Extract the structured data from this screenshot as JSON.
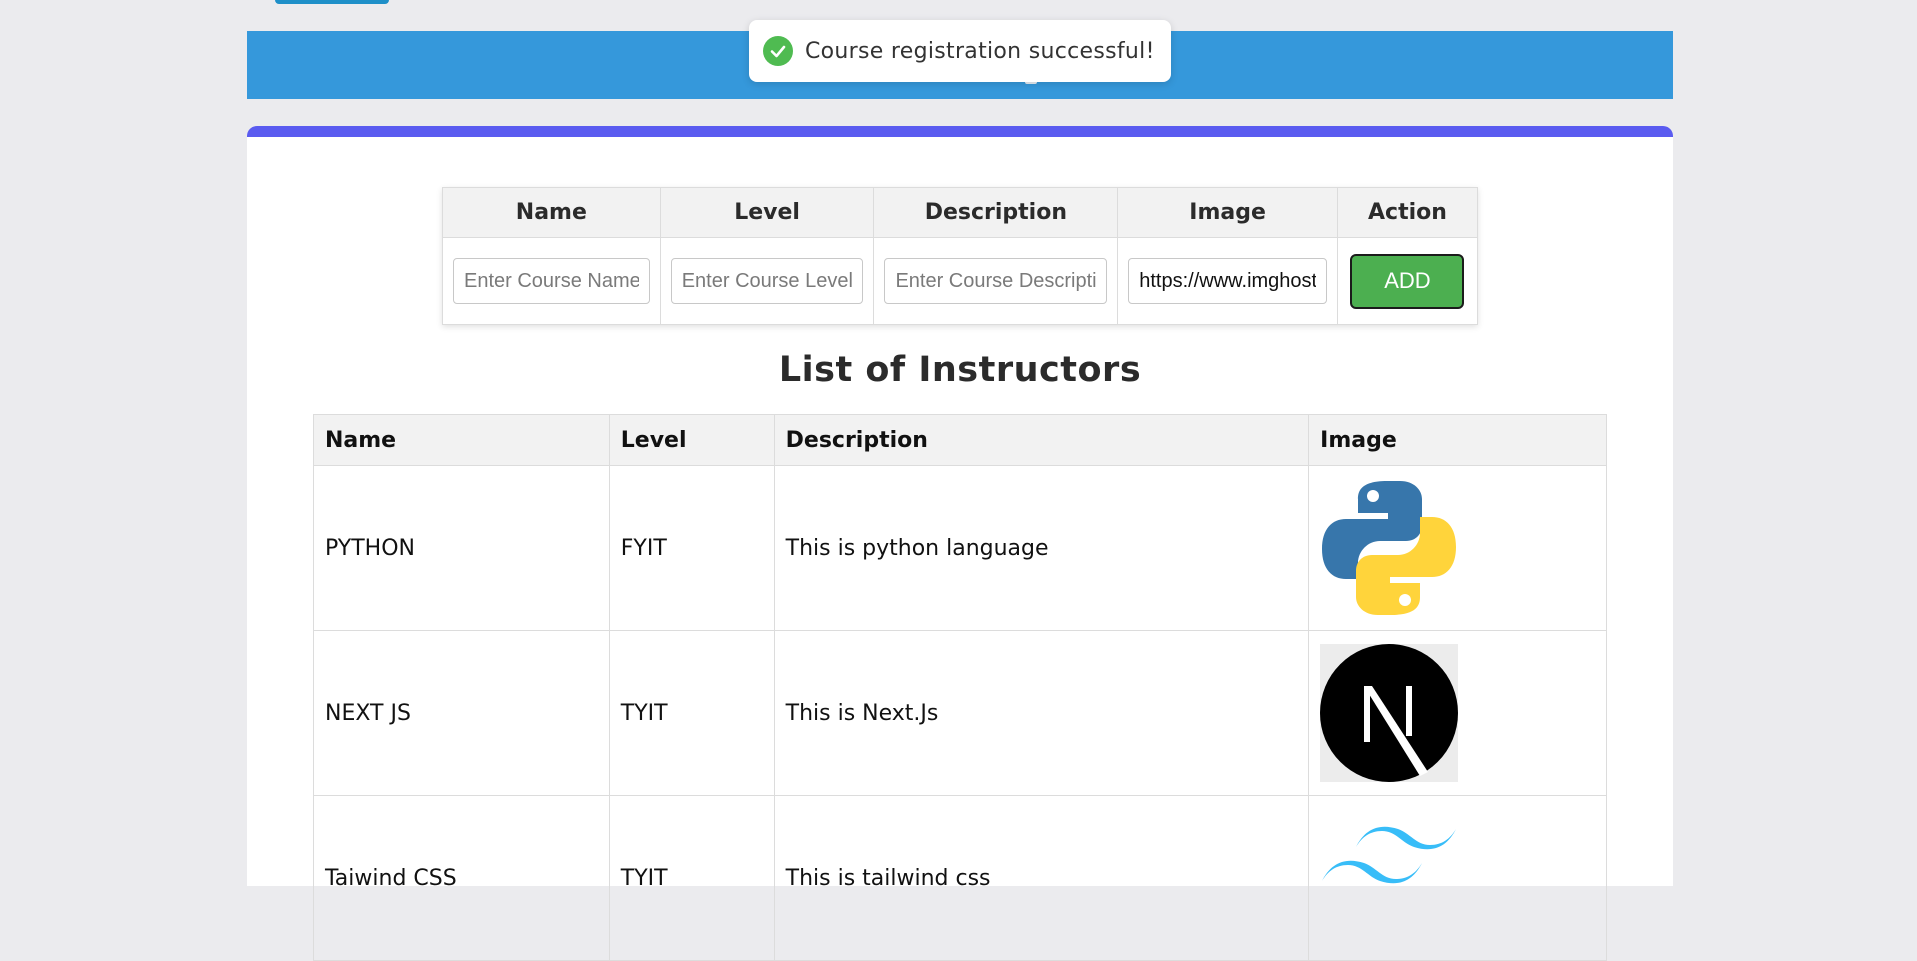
{
  "toast": {
    "message": "Course registration successful!",
    "icon": "check-circle-icon",
    "color": "#4fbb51"
  },
  "colors": {
    "header": "#3598db",
    "card_accent": "#5a5bf0",
    "add_button": "#4caf50",
    "page_bg": "#ebebee"
  },
  "form": {
    "headers": [
      "Name",
      "Level",
      "Description",
      "Image",
      "Action"
    ],
    "name_placeholder": "Enter Course Name",
    "level_placeholder": "Enter Course Level",
    "description_placeholder": "Enter Course Description",
    "image_value": "https://www.imghost",
    "add_label": "ADD"
  },
  "list": {
    "title": "List of Instructors",
    "headers": [
      "Name",
      "Level",
      "Description",
      "Image"
    ],
    "rows": [
      {
        "name": "PYTHON",
        "level": "FYIT",
        "description": "This is python language",
        "image": "python-logo"
      },
      {
        "name": "NEXT JS",
        "level": "TYIT",
        "description": "This is Next.Js",
        "image": "nextjs-logo"
      },
      {
        "name": "Taiwind CSS",
        "level": "TYIT",
        "description": "This is tailwind css",
        "image": "tailwind-logo"
      }
    ]
  }
}
